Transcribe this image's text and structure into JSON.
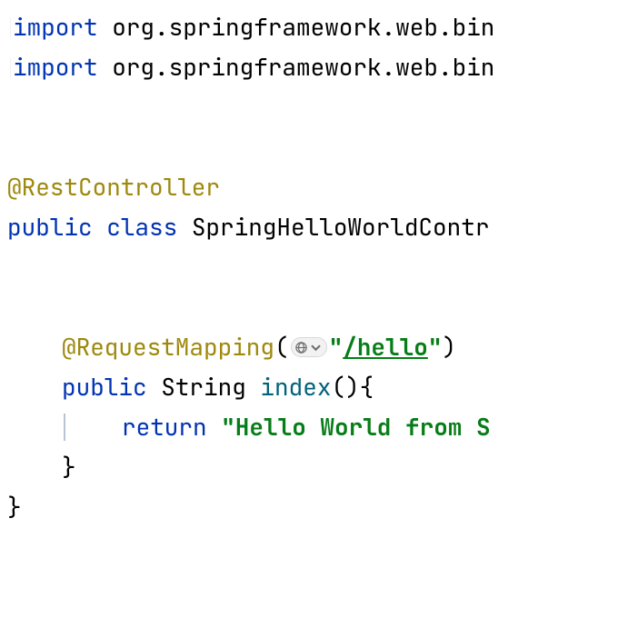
{
  "code": {
    "import_kw": "import",
    "pkg1": " org.springframework.web.bin",
    "pkg2": " org.springframework.web.bin",
    "anno_rest": "@RestController",
    "public_kw": "public",
    "class_kw": "class",
    "class_name": " SpringHelloWorldContr",
    "anno_reqmap": "@RequestMapping",
    "lparen": "(",
    "url_q1": "\"",
    "url_path": "/hello",
    "url_q2": "\"",
    "rparen": ")",
    "return_type": " String ",
    "method_name": "index",
    "method_sig_end": "(){",
    "return_kw": "return",
    "ret_string": " \"Hello World from S",
    "brace_close": "}"
  }
}
